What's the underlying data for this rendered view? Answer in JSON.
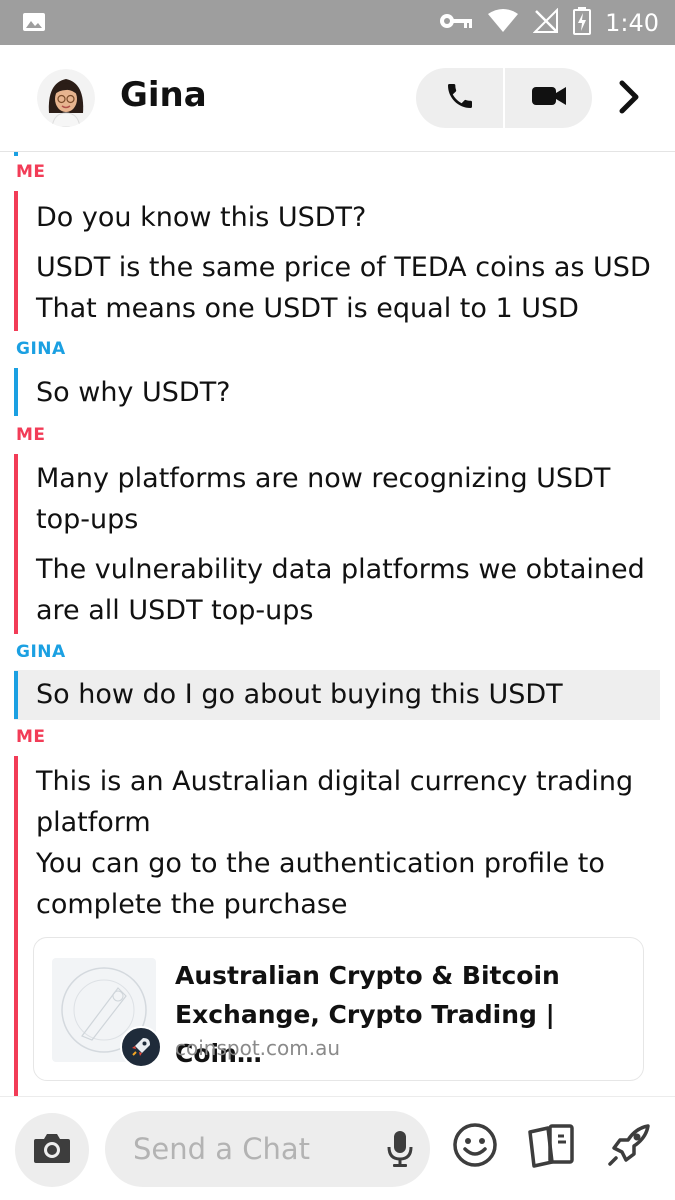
{
  "status_bar": {
    "time": "1:40"
  },
  "header": {
    "contact_name": "Gina"
  },
  "messages": [
    {
      "sender": "ME",
      "lines": [
        "Do you know this USDT?"
      ]
    },
    {
      "sender": "ME",
      "lines": [
        "USDT is the same price of TEDA coins as USD",
        "That means one USDT is equal to 1 USD"
      ]
    },
    {
      "sender": "GINA",
      "lines": [
        "So why USDT?"
      ]
    },
    {
      "sender": "ME",
      "lines": [
        "Many platforms are now recognizing USDT",
        "top-ups"
      ]
    },
    {
      "sender": "ME",
      "lines": [
        "The vulnerability data platforms we obtained",
        "are all USDT top-ups"
      ]
    },
    {
      "sender": "GINA",
      "lines": [
        "So how do I go about buying this USDT"
      ]
    },
    {
      "sender": "ME",
      "lines": [
        "This is an Australian digital currency trading",
        "platform",
        "You can go to the authentication profile to",
        "complete the purchase"
      ]
    }
  ],
  "link_preview": {
    "title_line1": "Australian Crypto & Bitcoin",
    "title_line2": "Exchange, Crypto Trading | Coin…",
    "domain": "coinspot.com.au"
  },
  "composer": {
    "placeholder": "Send a Chat"
  },
  "colors": {
    "me": "#f23c57",
    "gina": "#1ba0e2",
    "status_bar": "#9e9e9e"
  }
}
